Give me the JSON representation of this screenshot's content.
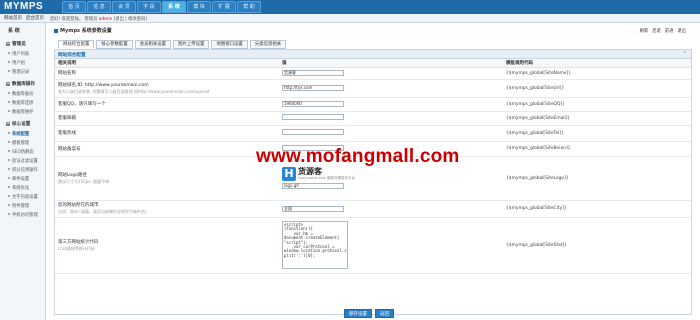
{
  "app": {
    "logo": "MYMPS"
  },
  "topnav": {
    "tabs": [
      {
        "label": "首 页"
      },
      {
        "label": "信 息"
      },
      {
        "label": "会 员"
      },
      {
        "label": "字 段"
      },
      {
        "label": "系 统",
        "active": true
      },
      {
        "label": "模 块"
      },
      {
        "label": "扩 展"
      },
      {
        "label": "帮 助"
      }
    ]
  },
  "topright": "",
  "subbar": {
    "quick1": "网站首页",
    "quick2": "后台首页",
    "welcome_pre": "您好! 欢迎登陆。 管理员 ",
    "welcome_user": "admin",
    "welcome_post": " [退出 | 修改密码]"
  },
  "sidebar": {
    "title": "系 统",
    "groups": [
      {
        "label": "管理员",
        "items": [
          {
            "label": "用户列表"
          },
          {
            "label": "用户组"
          },
          {
            "label": "管理记录"
          }
        ]
      },
      {
        "label": "数据库操作",
        "items": [
          {
            "label": "数据库备份"
          },
          {
            "label": "数据库还原"
          },
          {
            "label": "数据库维护"
          }
        ]
      },
      {
        "label": "核心设置",
        "items": [
          {
            "label": "系统配置",
            "active": true
          },
          {
            "label": "模板管理"
          },
          {
            "label": "SEO伪静态"
          },
          {
            "label": "验证过滤设置"
          },
          {
            "label": "积分信用操作"
          },
          {
            "label": "邮件设置"
          },
          {
            "label": "系统优化"
          },
          {
            "label": "文字内容设置"
          },
          {
            "label": "附件管理"
          },
          {
            "label": "手机访问管理"
          }
        ]
      }
    ]
  },
  "main": {
    "title": "Mymps 系统参数设置",
    "right_links": [
      "刷新",
      "后退",
      "前进",
      "退出"
    ],
    "tabs": [
      {
        "label": "网站综合配置",
        "active": true
      },
      {
        "label": "核心参数配置"
      },
      {
        "label": "会员相关设置"
      },
      {
        "label": "图片上传设置"
      },
      {
        "label": "地图接口设置"
      },
      {
        "label": "分类信息相关"
      }
    ],
    "section_title": "网站综合配置",
    "columns": [
      "相关说明",
      "值",
      "模板调用代码"
    ],
    "rows": [
      {
        "label": "网站名称",
        "sub": "",
        "value": "货源客",
        "code": "{$mymps_global[SiteName]}"
      },
      {
        "label": "网站域名,如: http://www.yourdomain.com",
        "sub": "若为二级目录安装, 则需填写二级目录路径,如http://www.yourdomain.com/upload",
        "value": "http://tyx.com",
        "code": "{$mymps_global[SiteUrl]}"
      },
      {
        "label": "客服QQ，请只填写一个",
        "sub": "",
        "value": "5984000",
        "code": "{$mymps_global[SiteQQ]}"
      },
      {
        "label": "客服邮箱",
        "sub": "",
        "value": "",
        "code": "{$mymps_global[SiteEmail]}"
      },
      {
        "label": "客服热线",
        "sub": "",
        "value": "",
        "code": "{$mymps_global[SiteTel]}"
      },
      {
        "label": "网站备案号",
        "sub": "",
        "value": "",
        "code": "{$mymps_global[SiteBeian]}"
      },
      {
        "label": "网站Logo路径",
        "sub": "建议尺寸为150px, 图要不带",
        "value": "logo.gif",
        "code": "{$mymps_global[SiteLogo]}",
        "logo": true
      },
      {
        "label": "您的网站所在的城市",
        "sub": "比如：郑州 (请填，请用当前城市全称作为城市名)",
        "value": "全国",
        "code": "{$mymps_global[SiteCity]}"
      },
      {
        "label": "第三方网站统计代码",
        "sub": "cnzz量统等统计代码",
        "value": "<script>\n(function(){\n    var hm =\ndocument.createElement(\n\"script\");\n    var curProtocol =\nwindow.location.protocol.s\nplit(':')[0];",
        "code": "{$mymps_global[SiteStat]}",
        "textarea": true
      }
    ],
    "logo_preview": {
      "letter": "H",
      "name": "货源客",
      "domain": "huoyuanke.com",
      "tagline": "微商货源发布平台"
    },
    "buttons": [
      "保存设置",
      "返回"
    ]
  },
  "watermark": "www.mofangmall.com"
}
